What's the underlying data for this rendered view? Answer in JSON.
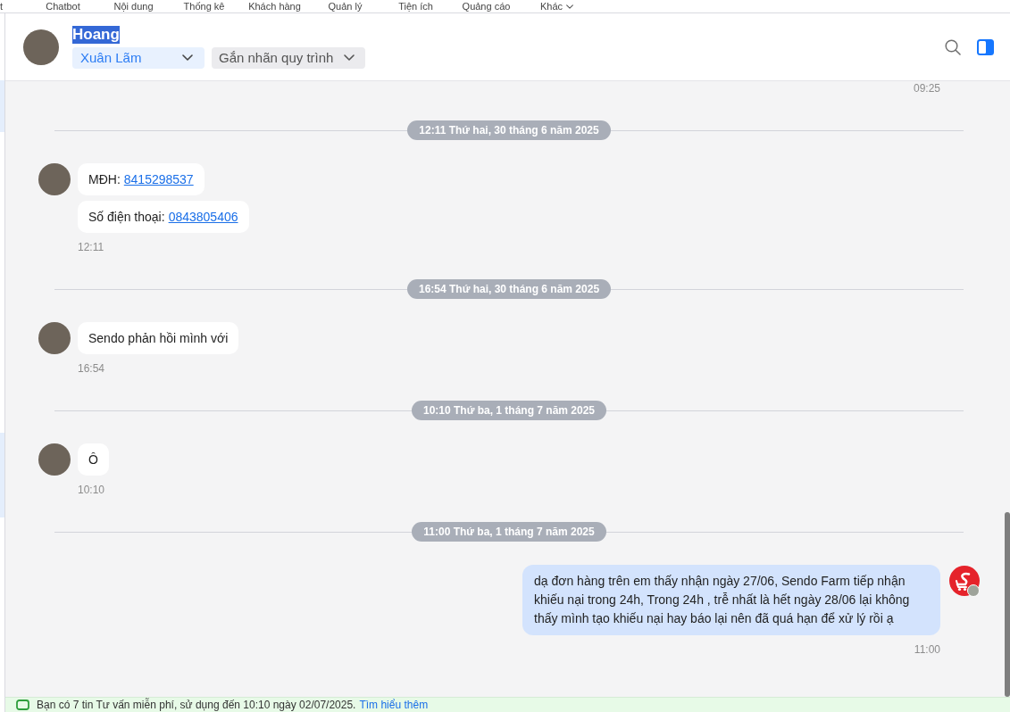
{
  "nav": {
    "items": [
      {
        "label": "t",
        "kind": "link"
      },
      {
        "label": "Chatbot",
        "kind": "link"
      },
      {
        "label": "Nội dung",
        "kind": "link"
      },
      {
        "label": "Thống kê",
        "kind": "link"
      },
      {
        "label": "Khách hàng",
        "kind": "link"
      },
      {
        "label": "Quản lý",
        "kind": "link"
      },
      {
        "label": "Tiện ích",
        "kind": "link"
      },
      {
        "label": "Quảng cáo",
        "kind": "link"
      },
      {
        "label": "Khác",
        "kind": "menu"
      }
    ]
  },
  "conversation": {
    "contact": {
      "name": "Hoang",
      "highlighted": true
    },
    "assignee": {
      "value": "Xuân Lãm"
    },
    "process_tag": {
      "placeholder": "Gắn nhãn quy trình"
    }
  },
  "chat": {
    "items": [
      {
        "kind": "time",
        "outgoing": true,
        "text": "09:25"
      },
      {
        "kind": "separator",
        "text": "12:11 Thứ hai, 30 tháng 6 năm 2025"
      },
      {
        "kind": "group",
        "outgoing": false,
        "messages": [
          {
            "text": "MĐH:",
            "link": "8415298537"
          },
          {
            "text": "Số điện thoại:",
            "link": "0843805406"
          }
        ],
        "time": "12:11"
      },
      {
        "kind": "separator",
        "text": "16:54 Thứ hai, 30 tháng 6 năm 2025"
      },
      {
        "kind": "group",
        "outgoing": false,
        "messages": [
          {
            "text": "Sendo phản hồi mình với"
          }
        ],
        "time": "16:54"
      },
      {
        "kind": "separator",
        "text": "10:10 Thứ ba, 1 tháng 7 năm 2025"
      },
      {
        "kind": "group",
        "outgoing": false,
        "messages": [
          {
            "text": "Ô"
          }
        ],
        "time": "10:10"
      },
      {
        "kind": "separator",
        "text": "11:00 Thứ ba, 1 tháng 7 năm 2025"
      },
      {
        "kind": "group",
        "outgoing": true,
        "messages": [
          {
            "text": "dạ đơn hàng trên em thấy nhận ngày 27/06, Sendo Farm tiếp nhận khiếu nại trong 24h, Trong 24h , trễ nhất là hết ngày 28/06 lại không thấy mình tạo khiếu nại hay báo lại nên đã quá hạn để xử lý rồi ạ"
          }
        ],
        "time": "11:00"
      }
    ]
  },
  "notice": {
    "text": "Bạn có 7 tin Tư vấn miễn phí, sử dụng đến 10:10 ngày 02/07/2025.",
    "link": "Tìm hiểu thêm"
  }
}
